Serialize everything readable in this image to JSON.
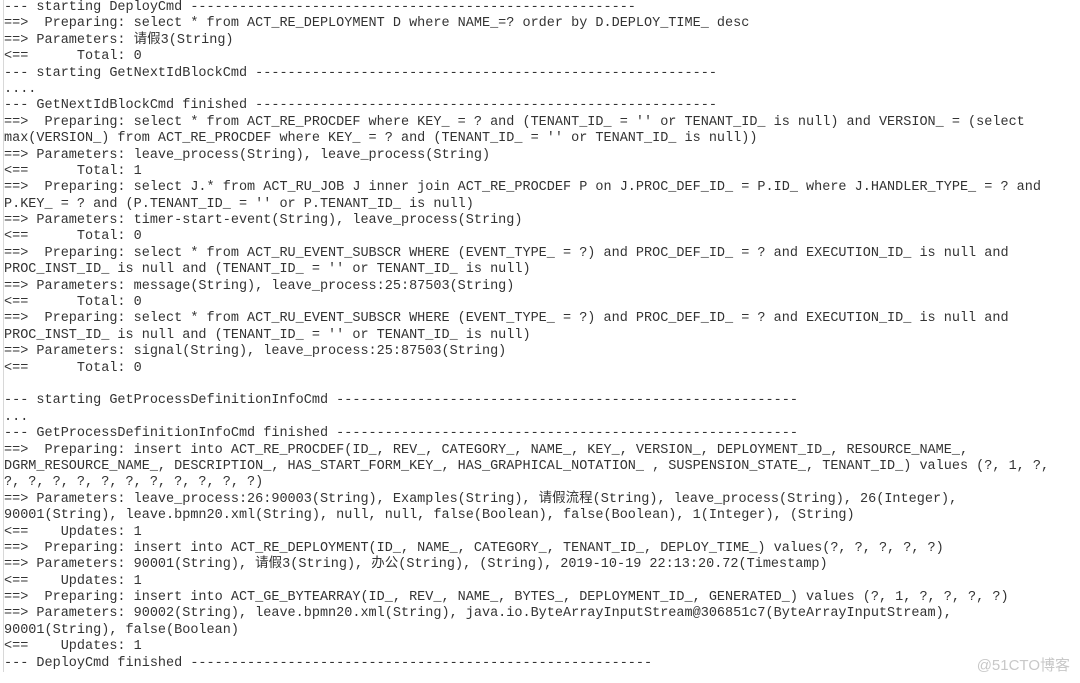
{
  "console": {
    "lines": [
      "--- starting DeployCmd -------------------------------------------------------",
      "==>  Preparing: select * from ACT_RE_DEPLOYMENT D where NAME_=? order by D.DEPLOY_TIME_ desc",
      "==> Parameters: 请假3(String)",
      "<==      Total: 0",
      "--- starting GetNextIdBlockCmd ---------------------------------------------------------",
      "....",
      "--- GetNextIdBlockCmd finished ---------------------------------------------------------",
      "==>  Preparing: select * from ACT_RE_PROCDEF where KEY_ = ? and (TENANT_ID_ = '' or TENANT_ID_ is null) and VERSION_ = (select",
      "max(VERSION_) from ACT_RE_PROCDEF where KEY_ = ? and (TENANT_ID_ = '' or TENANT_ID_ is null))",
      "==> Parameters: leave_process(String), leave_process(String)",
      "<==      Total: 1",
      "==>  Preparing: select J.* from ACT_RU_JOB J inner join ACT_RE_PROCDEF P on J.PROC_DEF_ID_ = P.ID_ where J.HANDLER_TYPE_ = ? and",
      "P.KEY_ = ? and (P.TENANT_ID_ = '' or P.TENANT_ID_ is null)",
      "==> Parameters: timer-start-event(String), leave_process(String)",
      "<==      Total: 0",
      "==>  Preparing: select * from ACT_RU_EVENT_SUBSCR WHERE (EVENT_TYPE_ = ?) and PROC_DEF_ID_ = ? and EXECUTION_ID_ is null and",
      "PROC_INST_ID_ is null and (TENANT_ID_ = '' or TENANT_ID_ is null)",
      "==> Parameters: message(String), leave_process:25:87503(String)",
      "<==      Total: 0",
      "==>  Preparing: select * from ACT_RU_EVENT_SUBSCR WHERE (EVENT_TYPE_ = ?) and PROC_DEF_ID_ = ? and EXECUTION_ID_ is null and",
      "PROC_INST_ID_ is null and (TENANT_ID_ = '' or TENANT_ID_ is null)",
      "==> Parameters: signal(String), leave_process:25:87503(String)",
      "<==      Total: 0",
      "",
      "--- starting GetProcessDefinitionInfoCmd ---------------------------------------------------------",
      "...",
      "--- GetProcessDefinitionInfoCmd finished ---------------------------------------------------------",
      "==>  Preparing: insert into ACT_RE_PROCDEF(ID_, REV_, CATEGORY_, NAME_, KEY_, VERSION_, DEPLOYMENT_ID_, RESOURCE_NAME_,",
      "DGRM_RESOURCE_NAME_, DESCRIPTION_, HAS_START_FORM_KEY_, HAS_GRAPHICAL_NOTATION_ , SUSPENSION_STATE_, TENANT_ID_) values (?, 1, ?,",
      "?, ?, ?, ?, ?, ?, ?, ?, ?, ?, ?)",
      "==> Parameters: leave_process:26:90003(String), Examples(String), 请假流程(String), leave_process(String), 26(Integer),",
      "90001(String), leave.bpmn20.xml(String), null, null, false(Boolean), false(Boolean), 1(Integer), (String)",
      "<==    Updates: 1",
      "==>  Preparing: insert into ACT_RE_DEPLOYMENT(ID_, NAME_, CATEGORY_, TENANT_ID_, DEPLOY_TIME_) values(?, ?, ?, ?, ?)",
      "==> Parameters: 90001(String), 请假3(String), 办公(String), (String), 2019-10-19 22:13:20.72(Timestamp)",
      "<==    Updates: 1",
      "==>  Preparing: insert into ACT_GE_BYTEARRAY(ID_, REV_, NAME_, BYTES_, DEPLOYMENT_ID_, GENERATED_) values (?, 1, ?, ?, ?, ?)",
      "==> Parameters: 90002(String), leave.bpmn20.xml(String), java.io.ByteArrayInputStream@306851c7(ByteArrayInputStream),",
      "90001(String), false(Boolean)",
      "<==    Updates: 1",
      "--- DeployCmd finished ---------------------------------------------------------"
    ]
  },
  "watermark": "@51CTO博客"
}
